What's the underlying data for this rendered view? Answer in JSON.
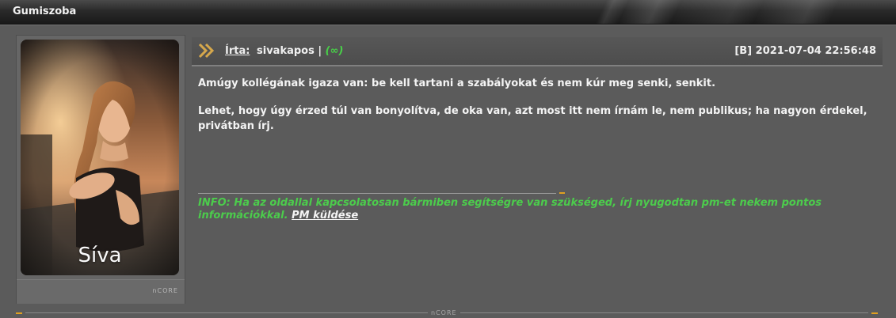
{
  "window": {
    "title": "Gumiszoba"
  },
  "sidebar": {
    "avatar_caption": "Síva",
    "brand": "nCORE"
  },
  "post": {
    "written_by_label": "Írta:",
    "author": "sivakapos",
    "separator": "|",
    "rank_open": "(",
    "rank_symbol": "∞",
    "rank_close": ")",
    "date": "[B] 2021-07-04 22:56:48",
    "paragraphs": [
      "Amúgy kollégának igaza van: be kell tartani a szabályokat és nem kúr meg senki, senkit.",
      "Lehet, hogy úgy érzed túl van bonyolítva, de oka van, azt most itt nem írnám le, nem publikus; ha nagyon érdekel, privátban írj."
    ],
    "signature": "INFO: Ha az oldallal kapcsolatosan bármiben segítségre van szükséged, írj nyugodtan pm-et nekem pontos információkkal.",
    "pm_link": "PM küldése"
  },
  "footer": {
    "brand": "nCORE"
  },
  "colors": {
    "accent": "#e0a020",
    "signature": "#4ccc4c",
    "background": "#5b5b5b"
  }
}
